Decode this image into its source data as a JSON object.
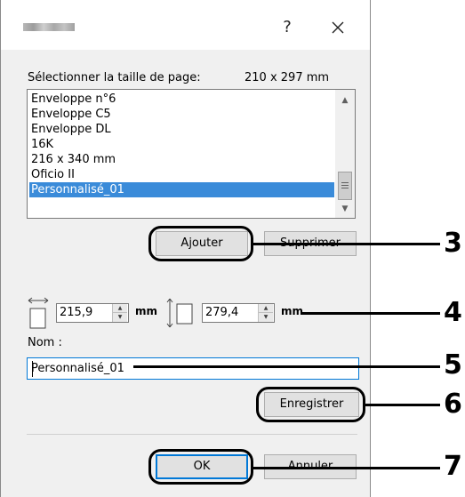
{
  "dialog": {
    "help_label": "?",
    "close_label": "×"
  },
  "page_size": {
    "label": "Sélectionner la taille de page:",
    "current": "210 x 297 mm",
    "items": [
      "Enveloppe n°6",
      "Enveloppe C5",
      "Enveloppe DL",
      "16K",
      "216 x 340 mm",
      "Oficio II",
      "Personnalisé_01"
    ],
    "selected_index": 6
  },
  "buttons": {
    "add": "Ajouter",
    "delete": "Supprimer",
    "save": "Enregistrer",
    "ok": "OK",
    "cancel": "Annuler"
  },
  "dimensions": {
    "width_value": "215,9",
    "width_unit": "mm",
    "height_value": "279,4",
    "height_unit": "mm"
  },
  "name_field": {
    "label": "Nom :",
    "value": "Personnalisé_01"
  },
  "callouts": [
    "3",
    "4",
    "5",
    "6",
    "7"
  ],
  "colors": {
    "selection": "#3a8bd9",
    "focus_border": "#0078d7",
    "dialog_bg": "#f0f0f0"
  }
}
